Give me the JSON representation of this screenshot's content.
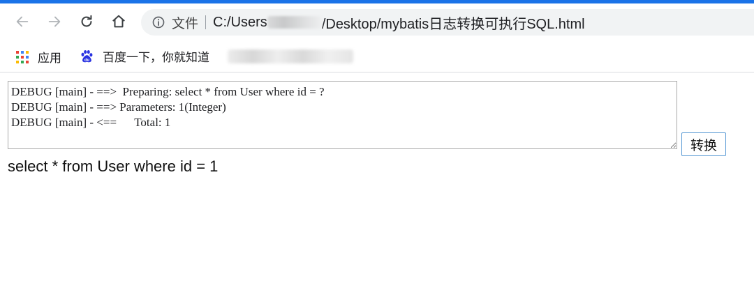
{
  "browser": {
    "icons": {
      "back": "back-arrow-icon",
      "forward": "forward-arrow-icon",
      "reload": "reload-icon",
      "home": "home-icon",
      "info": "info-icon"
    },
    "address_chip": "文件",
    "url_prefix": "C:/Users",
    "url_suffix": "/Desktop/mybatis日志转换可执行SQL.html",
    "accent_color": "#1a73e8"
  },
  "bookmarks": {
    "items": [
      {
        "label": "应用",
        "icon": "apps-grid-icon"
      },
      {
        "label": "百度一下，你就知道",
        "icon": "baidu-paw-icon"
      }
    ]
  },
  "page": {
    "log_text": "DEBUG [main] - ==>  Preparing: select * from User where id = ?\nDEBUG [main] - ==> Parameters: 1(Integer)\nDEBUG [main] - <==      Total: 1",
    "convert_label": "转换",
    "result_sql": "select * from User where id = 1"
  }
}
